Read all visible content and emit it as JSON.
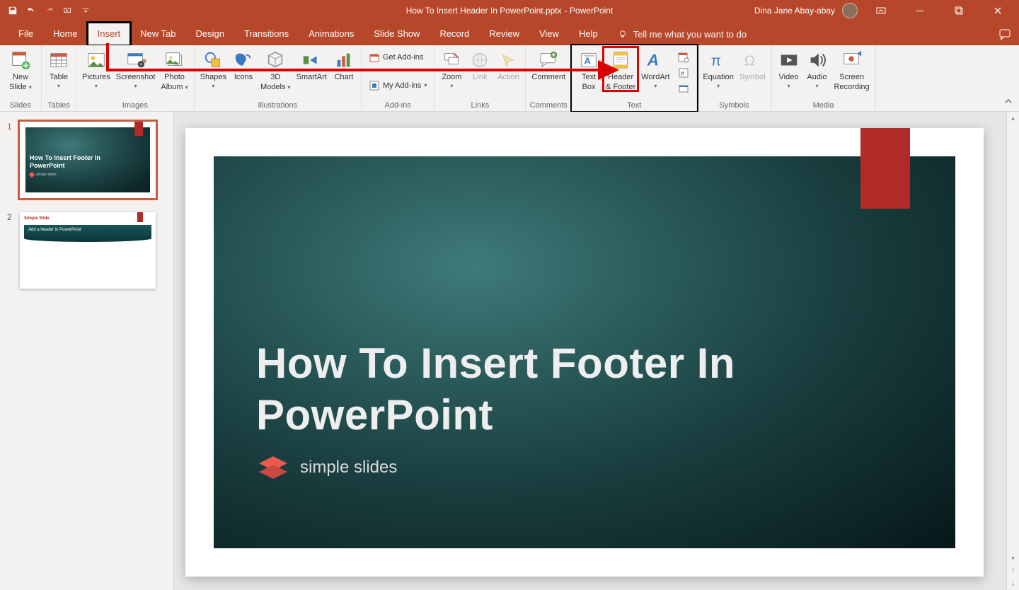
{
  "title_bar": {
    "doc_title": "How To Insert Header In PowerPoint.pptx",
    "app_suffix": "  -  PowerPoint",
    "user_name": "Dina Jane Abay-abay"
  },
  "tabs": {
    "file": "File",
    "home": "Home",
    "insert": "Insert",
    "newtab": "New Tab",
    "design": "Design",
    "transitions": "Transitions",
    "animations": "Animations",
    "slideshow": "Slide Show",
    "record": "Record",
    "review": "Review",
    "view": "View",
    "help": "Help",
    "tellme": "Tell me what you want to do"
  },
  "ribbon": {
    "slides": {
      "new_slide_l1": "New",
      "new_slide_l2": "Slide",
      "group": "Slides"
    },
    "tables": {
      "table": "Table",
      "group": "Tables"
    },
    "images": {
      "pictures": "Pictures",
      "screenshot": "Screenshot",
      "photo_album_l1": "Photo",
      "photo_album_l2": "Album",
      "group": "Images"
    },
    "illustrations": {
      "shapes": "Shapes",
      "icons": "Icons",
      "models_l1": "3D",
      "models_l2": "Models",
      "smartart": "SmartArt",
      "chart": "Chart",
      "group": "Illustrations"
    },
    "addins": {
      "get": "Get Add-ins",
      "my": "My Add-ins",
      "group": "Add-ins"
    },
    "links": {
      "zoom": "Zoom",
      "link": "Link",
      "action": "Action",
      "group": "Links"
    },
    "comments": {
      "comment": "Comment",
      "group": "Comments"
    },
    "text": {
      "text_box_l1": "Text",
      "text_box_l2": "Box",
      "header_l1": "Header",
      "header_l2": "& Footer",
      "wordart": "WordArt",
      "group": "Text"
    },
    "symbols": {
      "equation": "Equation",
      "symbol": "Symbol",
      "group": "Symbols"
    },
    "media": {
      "video": "Video",
      "audio": "Audio",
      "screen_l1": "Screen",
      "screen_l2": "Recording",
      "group": "Media"
    }
  },
  "thumbs": {
    "n1": "1",
    "n2": "2",
    "t1_title_l1": "How To Insert Footer In",
    "t1_title_l2": "PowerPoint",
    "t1_logo": "simple slides",
    "t2_head": "Simple Slide",
    "t2_text": "Add a header in PowerPoint"
  },
  "slide": {
    "title_l1": "How To Insert Footer In",
    "title_l2": "PowerPoint",
    "logo_text": "simple slides"
  }
}
